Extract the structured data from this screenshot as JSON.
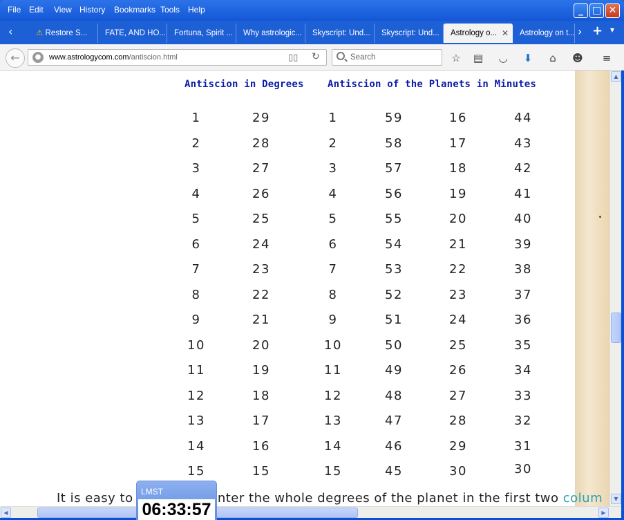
{
  "menu": [
    "File",
    "Edit",
    "View",
    "History",
    "Bookmarks",
    "Tools",
    "Help"
  ],
  "window_controls": {
    "minimize": "_",
    "maximize": "□",
    "close": "✕"
  },
  "tabs": [
    {
      "label": "Restore S...",
      "warning": true
    },
    {
      "label": "FATE, AND HO..."
    },
    {
      "label": "Fortuna, Spirit ..."
    },
    {
      "label": "Why astrologic..."
    },
    {
      "label": "Skyscript: Und..."
    },
    {
      "label": "Skyscript: Und..."
    },
    {
      "label": "Astrology o...",
      "active": true
    },
    {
      "label": "Astrology on t..."
    }
  ],
  "tab_controls": {
    "scroll_left": "‹",
    "scroll_right": "›",
    "new_tab": "+",
    "list": "▾",
    "close": "✕"
  },
  "address": {
    "domain": "www.astrologycom.com",
    "path": "/antiscion.html"
  },
  "search": {
    "placeholder": "Search"
  },
  "table": {
    "header_left": "Antiscion in Degrees",
    "header_right": "Antiscion of the Planets in Minutes",
    "rows": [
      [
        "1",
        "29",
        "1",
        "59",
        "16",
        "44"
      ],
      [
        "2",
        "28",
        "2",
        "58",
        "17",
        "43"
      ],
      [
        "3",
        "27",
        "3",
        "57",
        "18",
        "42"
      ],
      [
        "4",
        "26",
        "4",
        "56",
        "19",
        "41"
      ],
      [
        "5",
        "25",
        "5",
        "55",
        "20",
        "40"
      ],
      [
        "6",
        "24",
        "6",
        "54",
        "21",
        "39"
      ],
      [
        "7",
        "23",
        "7",
        "53",
        "22",
        "38"
      ],
      [
        "8",
        "22",
        "8",
        "52",
        "23",
        "37"
      ],
      [
        "9",
        "21",
        "9",
        "51",
        "24",
        "36"
      ],
      [
        "10",
        "20",
        "10",
        "50",
        "25",
        "35"
      ],
      [
        "11",
        "19",
        "11",
        "49",
        "26",
        "34"
      ],
      [
        "12",
        "18",
        "12",
        "48",
        "27",
        "33"
      ],
      [
        "13",
        "17",
        "13",
        "47",
        "28",
        "32"
      ],
      [
        "14",
        "16",
        "14",
        "46",
        "29",
        "31"
      ],
      [
        "15",
        "15",
        "15",
        "45",
        "30",
        "30"
      ]
    ]
  },
  "paragraph": {
    "before": "It is easy to ",
    "middle": "nter the whole degrees of the planet in the first two ",
    "link": "colum"
  },
  "widget": {
    "title": "LMST",
    "time": "06:33:57"
  },
  "colors": {
    "header_blue": "#0a1ba8",
    "xp_blue": "#1457d6",
    "link": "#2aa2b0"
  }
}
